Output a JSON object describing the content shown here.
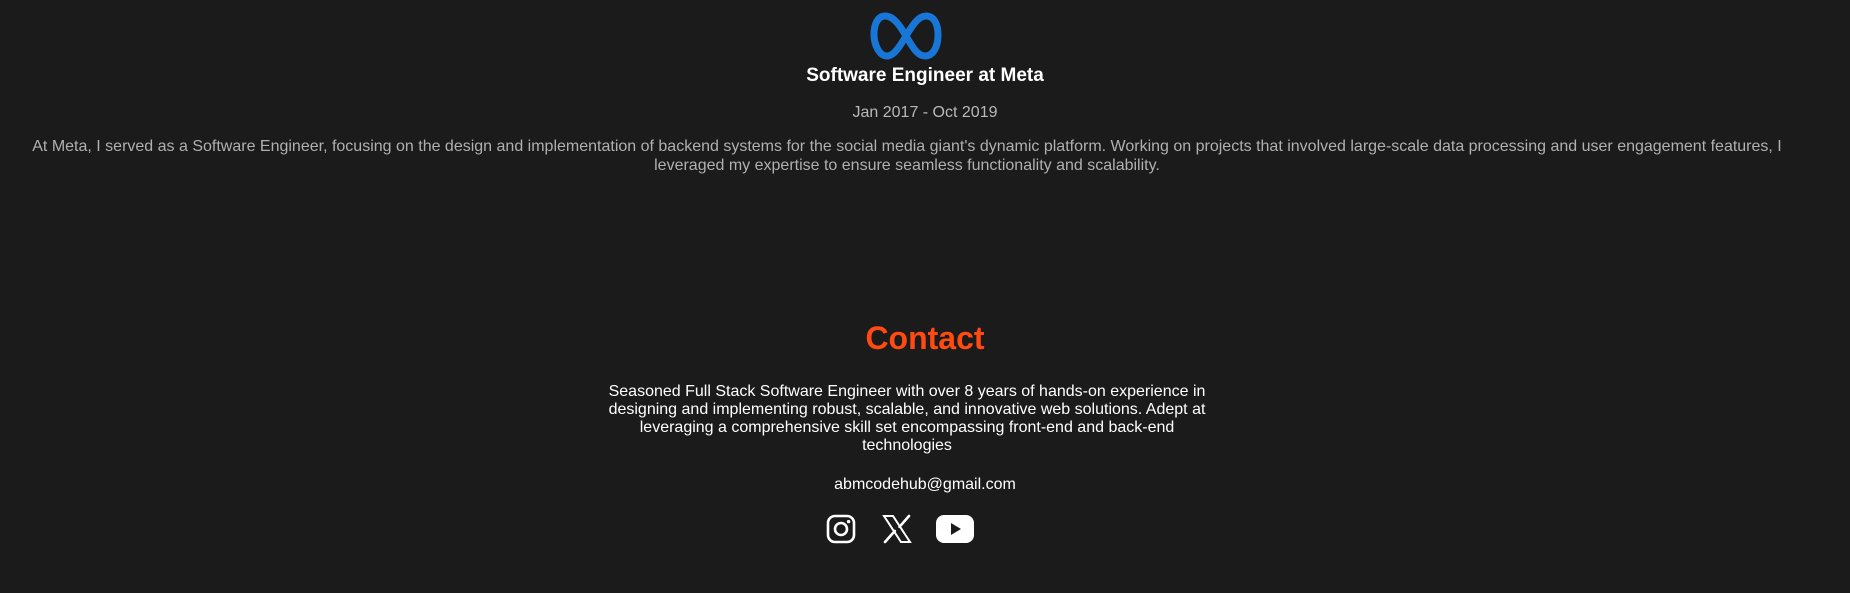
{
  "experience": {
    "logo_icon": "meta-logo",
    "logo_color": "#1877d6",
    "title": "Software Engineer at Meta",
    "dates": "Jan 2017 - Oct 2019",
    "description": "At Meta, I served as a Software Engineer, focusing on the design and implementation of backend systems for the social media giant's dynamic platform. Working on projects that involved large-scale data processing and user engagement features, I leveraged my expertise to ensure seamless functionality and scalability."
  },
  "contact": {
    "heading": "Contact",
    "heading_color": "#ff4a12",
    "bio": "Seasoned Full Stack Software Engineer with over 8 years of hands-on experience in designing and implementing robust, scalable, and innovative web solutions. Adept at leveraging a comprehensive skill set encompassing front-end and back-end technologies",
    "email": "abmcodehub@gmail.com",
    "social": [
      {
        "icon": "instagram-icon"
      },
      {
        "icon": "x-twitter-icon"
      },
      {
        "icon": "youtube-icon"
      }
    ]
  },
  "colors": {
    "background": "#1b1b1b",
    "text_primary": "#ffffff",
    "text_muted": "#b0b0b0"
  }
}
